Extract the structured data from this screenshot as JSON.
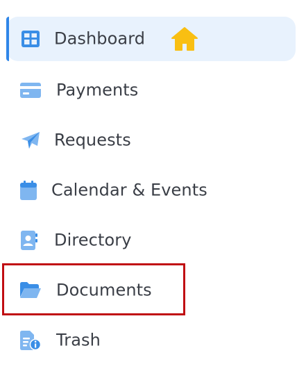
{
  "sidebar": {
    "items": [
      {
        "label": "Dashboard",
        "icon": "dashboard-grid-icon",
        "active": true
      },
      {
        "label": "Payments",
        "icon": "credit-card-icon"
      },
      {
        "label": "Requests",
        "icon": "paper-plane-icon"
      },
      {
        "label": "Calendar & Events",
        "icon": "calendar-icon"
      },
      {
        "label": "Directory",
        "icon": "contact-book-icon"
      },
      {
        "label": "Documents",
        "icon": "folder-open-icon",
        "highlighted": true
      },
      {
        "label": "Trash",
        "icon": "document-info-icon"
      }
    ],
    "badge_icon": "home-icon"
  },
  "colors": {
    "active_bg": "#e8f2fd",
    "active_bar": "#2f86e8",
    "icon_primary": "#3a8ee6",
    "icon_light": "#7fb6f0",
    "home_badge": "#f9bf12",
    "highlight_border": "#c00d12",
    "label_text": "#3a3e46"
  }
}
